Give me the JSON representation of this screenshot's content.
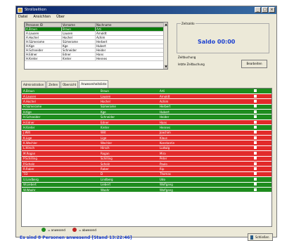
{
  "window": {
    "title": "Strollzeitkon"
  },
  "menu": [
    "Datei",
    "Ansichten",
    "Über"
  ],
  "top_table": {
    "headers": [
      "Personen ID",
      "Vorname",
      "Nachname"
    ],
    "rows": [
      [
        "A.Braun",
        "Braun",
        "Arti"
      ],
      [
        "A.Lausen",
        "Lausen",
        "Arnoldt"
      ],
      [
        "A.Hochel",
        "Hochel",
        "Achim"
      ],
      [
        "H.Sümerame",
        "Sümerame",
        "Herbert"
      ],
      [
        "H.Kge",
        "Kge",
        "Hubert"
      ],
      [
        "H.Schneider",
        "Schneider",
        "Heider"
      ],
      [
        "H.Edner",
        "Edner",
        "Hans"
      ],
      [
        "H.Kreter",
        "Kreter",
        "Hennes"
      ]
    ]
  },
  "zeitsaldo": {
    "legend": "Zeitsaldo",
    "saldo": "Saldo 00:00",
    "zeitbuchung": "Zeitbuchung",
    "letzte": "letzte Zeitbuchung",
    "button": "Bearbeiten"
  },
  "tabs": [
    "Administration",
    "Zeiten",
    "Übersicht",
    "Anwesenheitsliste"
  ],
  "main_rows": [
    {
      "id": "A.Braun",
      "first": "Braun",
      "last": "Arti",
      "status": "present"
    },
    {
      "id": "A.Lausen",
      "first": "Lausen",
      "last": "Arnoldt",
      "status": "absent"
    },
    {
      "id": "A.Hochel",
      "first": "Hochel",
      "last": "Achim",
      "status": "absent"
    },
    {
      "id": "H.Sümerame",
      "first": "Sümerame",
      "last": "Herbert",
      "status": "present"
    },
    {
      "id": "H.Kge",
      "first": "Kge",
      "last": "Hubert",
      "status": "present"
    },
    {
      "id": "H.Schneider",
      "first": "Schneider",
      "last": "Heider",
      "status": "present"
    },
    {
      "id": "H.Edner",
      "first": "Edner",
      "last": "Hans",
      "status": "absent"
    },
    {
      "id": "H.Kreter",
      "first": "Kreter",
      "last": "Hennes",
      "status": "present"
    },
    {
      "id": "J.Wilt",
      "first": "Wilt",
      "last": "Joachim",
      "status": "absent"
    },
    {
      "id": "K.Lige",
      "first": "Lige",
      "last": "Klaus",
      "status": "absent"
    },
    {
      "id": "K.Wechler",
      "first": "Wechler",
      "last": "Konstantin",
      "status": "absent"
    },
    {
      "id": "L.Hirsch",
      "first": "Hirsch",
      "last": "Ludwig",
      "status": "absent"
    },
    {
      "id": "M.Rogan",
      "first": "Rogan",
      "last": "Mira",
      "status": "absent"
    },
    {
      "id": "P.Schilling",
      "first": "Schilling",
      "last": "Peter",
      "status": "absent"
    },
    {
      "id": "P.Scholz",
      "first": "Scholz",
      "last": "Paulo",
      "status": "absent"
    },
    {
      "id": "R.Raber",
      "first": "Raber",
      "last": "Rip",
      "status": "absent"
    },
    {
      "id": "T.D",
      "first": "D",
      "last": "Thomas",
      "status": "absent"
    },
    {
      "id": "U.Lindberg",
      "first": "Lindberg",
      "last": "Udo",
      "status": "present"
    },
    {
      "id": "W.Liebert",
      "first": "Liebert",
      "last": "Wolfgang",
      "status": "present"
    },
    {
      "id": "W.Waahr",
      "first": "Waahr",
      "last": "Wolfgang",
      "status": "present"
    }
  ],
  "legend": {
    "present": "= anwesend",
    "absent": "= abwesend"
  },
  "status": {
    "text": "Es sind 8 Personen anwesend [Stand 13:22:46]"
  },
  "close_button": "Schließen",
  "colors": {
    "present": "#1e8c1e",
    "absent": "#e22a2a",
    "accent": "#1a3fd0"
  }
}
